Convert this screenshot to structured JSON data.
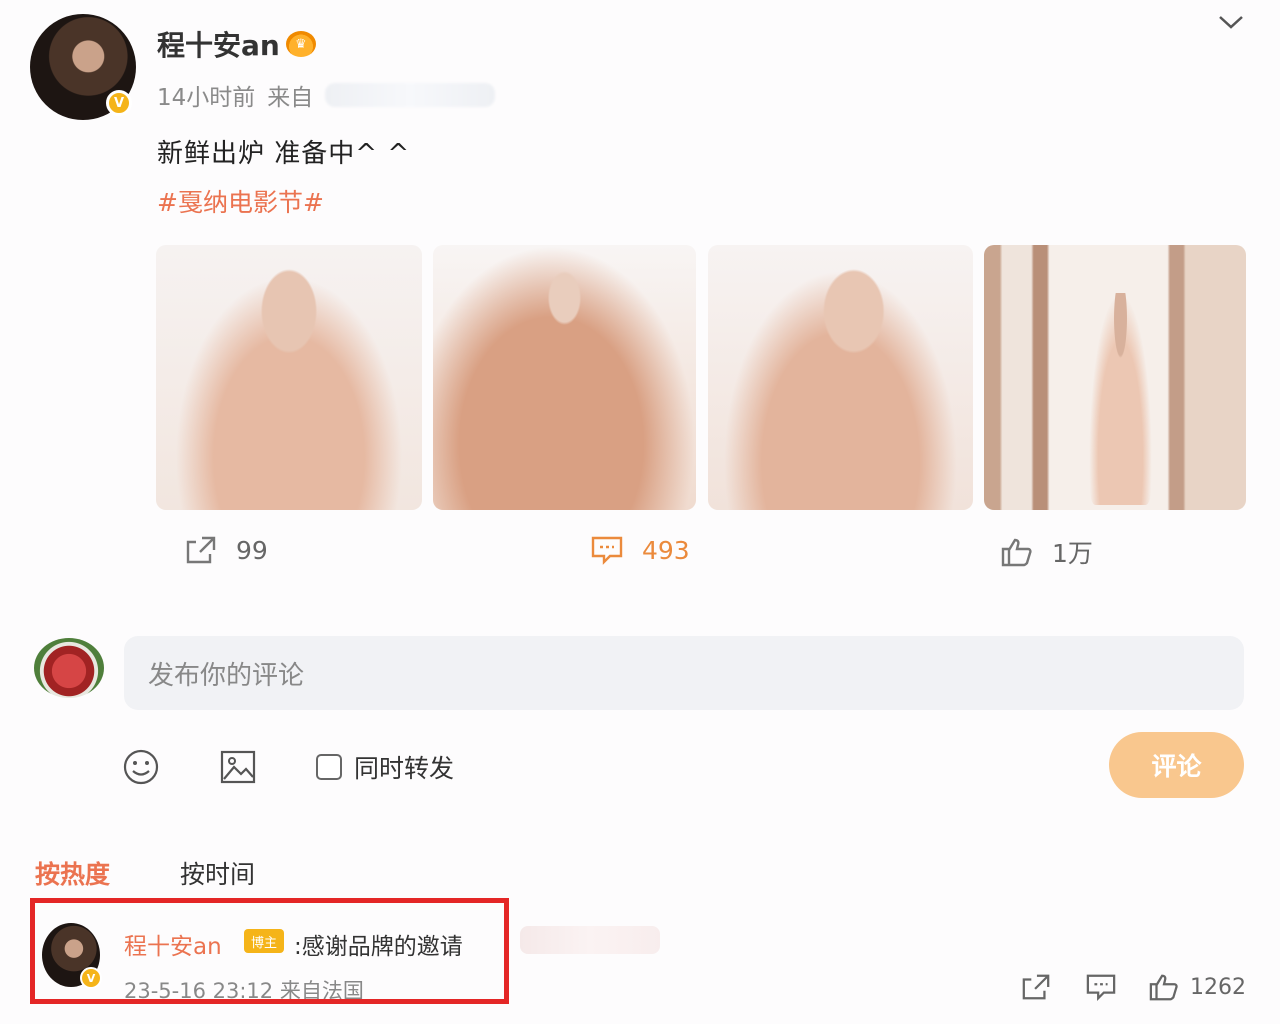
{
  "post": {
    "author": "程十安an",
    "time": "14小时前",
    "source_prefix": "来自",
    "text": "新鲜出炉 准备中^ ^",
    "hashtag": "#戛纳电影节#",
    "verified_badge": "V",
    "crown_badge": "♛"
  },
  "photos": [
    {
      "label": "photo-1"
    },
    {
      "label": "photo-2"
    },
    {
      "label": "photo-3"
    },
    {
      "label": "photo-4"
    }
  ],
  "actions": {
    "share_count": "99",
    "comment_count": "493",
    "like_count": "1万"
  },
  "composer": {
    "placeholder": "发布你的评论",
    "repost_label": "同时转发",
    "submit_label": "评论"
  },
  "sort": {
    "hot_label": "按热度",
    "time_label": "按时间"
  },
  "comment": {
    "author": "程十安an",
    "tag": "博主",
    "text": ":感谢品牌的邀请",
    "meta": "23-5-16 23:12 来自法国",
    "like_count": "1262"
  },
  "colors": {
    "accent": "#eb7350",
    "highlight_box": "#e42626",
    "submit_bg": "#f9c78e",
    "badge": "#f5b419"
  }
}
